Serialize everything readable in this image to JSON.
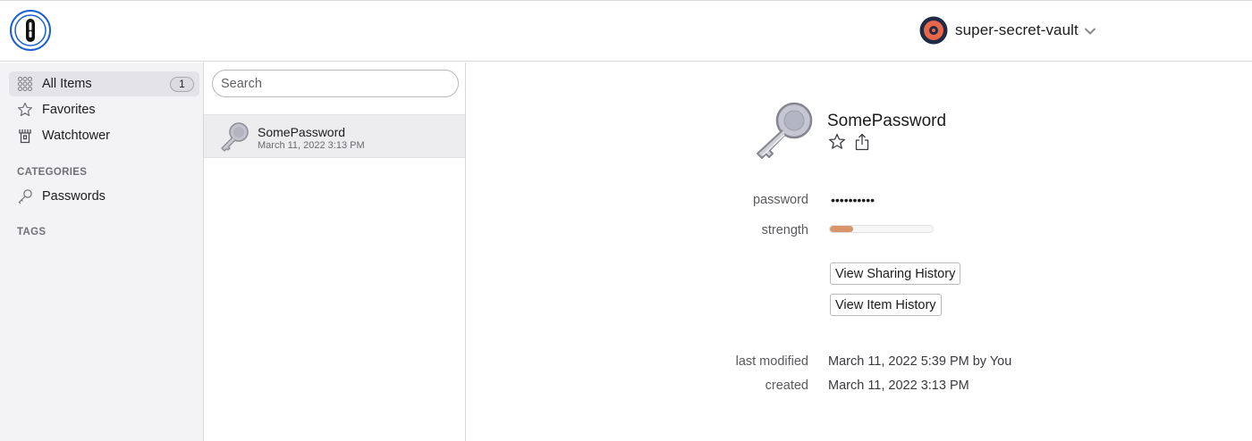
{
  "header": {
    "vault_name": "super-secret-vault",
    "logo_icon": "onepassword-logo-icon",
    "vault_icon": "vault-avatar-icon",
    "chevron_icon": "chevron-down-icon"
  },
  "sidebar": {
    "items": [
      {
        "label": "All Items",
        "icon": "all-items-icon",
        "count": "1",
        "active": true
      },
      {
        "label": "Favorites",
        "icon": "star-icon"
      },
      {
        "label": "Watchtower",
        "icon": "watchtower-icon"
      }
    ],
    "categories_heading": "CATEGORIES",
    "categories": [
      {
        "label": "Passwords",
        "icon": "key-icon"
      }
    ],
    "tags_heading": "TAGS"
  },
  "list": {
    "search_placeholder": "Search",
    "items": [
      {
        "title": "SomePassword",
        "subtitle": "March 11, 2022 3:13 PM",
        "icon": "key-icon"
      }
    ]
  },
  "detail": {
    "title": "SomePassword",
    "icon": "key-icon",
    "favorite_icon": "star-outline-icon",
    "share_icon": "share-icon",
    "fields": {
      "password_label": "password",
      "password_value": "••••••••••",
      "strength_label": "strength",
      "strength_fraction": 0.23,
      "strength_color": "#d9956a"
    },
    "buttons": {
      "sharing_history": "View Sharing History",
      "item_history": "View Item History"
    },
    "meta": {
      "last_modified_label": "last modified",
      "last_modified_value": "March 11, 2022 5:39 PM by You",
      "created_label": "created",
      "created_value": "March 11, 2022 3:13 PM"
    }
  },
  "colors": {
    "accent_blue": "#0a5fd8",
    "vault_orange": "#e8664a",
    "vault_navy": "#1f2a44"
  }
}
